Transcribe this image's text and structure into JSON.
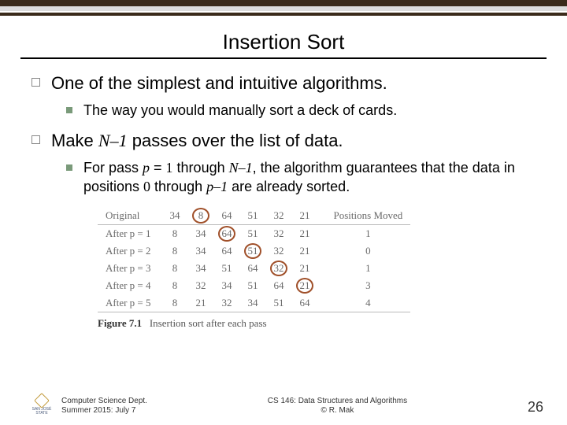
{
  "title": "Insertion Sort",
  "bullets": {
    "b1": "One of the simplest and intuitive algorithms.",
    "b1_1": "The way you would manually sort a deck of cards.",
    "b2_pre": "Make ",
    "b2_math": "N–1",
    "b2_post": " passes over the list of data.",
    "b2_1_a": "For pass ",
    "b2_1_p": "p",
    "b2_1_b": " = ",
    "b2_1_one": "1",
    "b2_1_c": " through ",
    "b2_1_n1": "N–1",
    "b2_1_d": ", the algorithm guarantees that the data in positions ",
    "b2_1_zero": "0",
    "b2_1_e": " through ",
    "b2_1_pm1": "p–1",
    "b2_1_f": " are already sorted."
  },
  "table": {
    "headers": [
      "Original",
      "34",
      "8",
      "64",
      "51",
      "32",
      "21",
      "Positions Moved"
    ],
    "rows": [
      {
        "label": "After p = 1",
        "vals": [
          "8",
          "34",
          "64",
          "51",
          "32",
          "21"
        ],
        "moved": "1",
        "circle": 2
      },
      {
        "label": "After p = 2",
        "vals": [
          "8",
          "34",
          "64",
          "51",
          "32",
          "21"
        ],
        "moved": "0",
        "circle": 3
      },
      {
        "label": "After p = 3",
        "vals": [
          "8",
          "34",
          "51",
          "64",
          "32",
          "21"
        ],
        "moved": "1",
        "circle": 4
      },
      {
        "label": "After p = 4",
        "vals": [
          "8",
          "32",
          "34",
          "51",
          "64",
          "21"
        ],
        "moved": "3",
        "circle": 5
      },
      {
        "label": "After p = 5",
        "vals": [
          "8",
          "21",
          "32",
          "34",
          "51",
          "64"
        ],
        "moved": "4",
        "circle": null
      }
    ],
    "header_circle": 1,
    "caption_label": "Figure 7.1",
    "caption_text": "Insertion sort after each pass"
  },
  "footer": {
    "logo_text": "SAN JOSÉ STATE",
    "left1": "Computer Science Dept.",
    "left2": "Summer 2015: July 7",
    "center1": "CS 146: Data Structures and Algorithms",
    "center2": "© R. Mak",
    "page": "26"
  }
}
